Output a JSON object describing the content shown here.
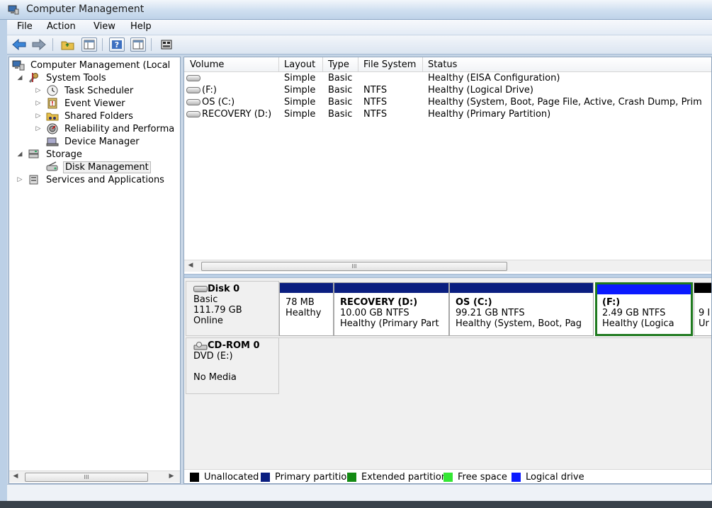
{
  "window": {
    "title": "Computer Management"
  },
  "menu": [
    "File",
    "Action",
    "View",
    "Help"
  ],
  "tree": {
    "root": "Computer Management (Local",
    "items": [
      {
        "label": "System Tools",
        "icon": "tools-icon"
      },
      {
        "label": "Task Scheduler",
        "icon": "clock-icon"
      },
      {
        "label": "Event Viewer",
        "icon": "event-log-icon"
      },
      {
        "label": "Shared Folders",
        "icon": "shared-folder-icon"
      },
      {
        "label": "Reliability and Performa",
        "icon": "gauge-icon"
      },
      {
        "label": "Device Manager",
        "icon": "device-manager-icon"
      },
      {
        "label": "Storage",
        "icon": "storage-icon"
      },
      {
        "label": "Disk Management",
        "icon": "disk-management-icon"
      },
      {
        "label": "Services and Applications",
        "icon": "services-icon"
      }
    ]
  },
  "volumes": {
    "columns": [
      "Volume",
      "Layout",
      "Type",
      "File System",
      "Status"
    ],
    "rows": [
      {
        "volume": "",
        "layout": "Simple",
        "type": "Basic",
        "fs": "",
        "status": "Healthy (EISA Configuration)"
      },
      {
        "volume": " (F:)",
        "layout": "Simple",
        "type": "Basic",
        "fs": "NTFS",
        "status": "Healthy (Logical Drive)"
      },
      {
        "volume": "OS (C:)",
        "layout": "Simple",
        "type": "Basic",
        "fs": "NTFS",
        "status": "Healthy (System, Boot, Page File, Active, Crash Dump, Prim"
      },
      {
        "volume": "RECOVERY (D:)",
        "layout": "Simple",
        "type": "Basic",
        "fs": "NTFS",
        "status": "Healthy (Primary Partition)"
      }
    ],
    "scroll_thumb": "III"
  },
  "disks": {
    "disk0": {
      "name": "Disk 0",
      "type": "Basic",
      "size": "111.79 GB",
      "state": "Online",
      "partitions": [
        {
          "name": "",
          "size": "78 MB",
          "status": "Healthy",
          "color": "#0a1e80"
        },
        {
          "name": "RECOVERY  (D:)",
          "size": "10.00 GB NTFS",
          "status": "Healthy (Primary Part",
          "color": "#0a1e80"
        },
        {
          "name": "OS  (C:)",
          "size": "99.21 GB NTFS",
          "status": "Healthy (System, Boot, Pag",
          "color": "#0a1e80"
        },
        {
          "name": " (F:)",
          "size": "2.49 GB NTFS",
          "status": "Healthy (Logica",
          "color": "#0a1aff"
        },
        {
          "name": "",
          "size": "9 I",
          "status": "Ur",
          "color": "#000000"
        }
      ]
    },
    "cdrom0": {
      "name": "CD-ROM 0",
      "type": "DVD (E:)",
      "media": "No Media"
    }
  },
  "legend": [
    {
      "label": "Unallocated",
      "color": "#000000"
    },
    {
      "label": "Primary partition",
      "color": "#0a1e80"
    },
    {
      "label": "Extended partition",
      "color": "#138a13"
    },
    {
      "label": "Free space",
      "color": "#33e633"
    },
    {
      "label": "Logical drive",
      "color": "#0a1aff"
    }
  ],
  "tree_scroll_thumb": "III"
}
